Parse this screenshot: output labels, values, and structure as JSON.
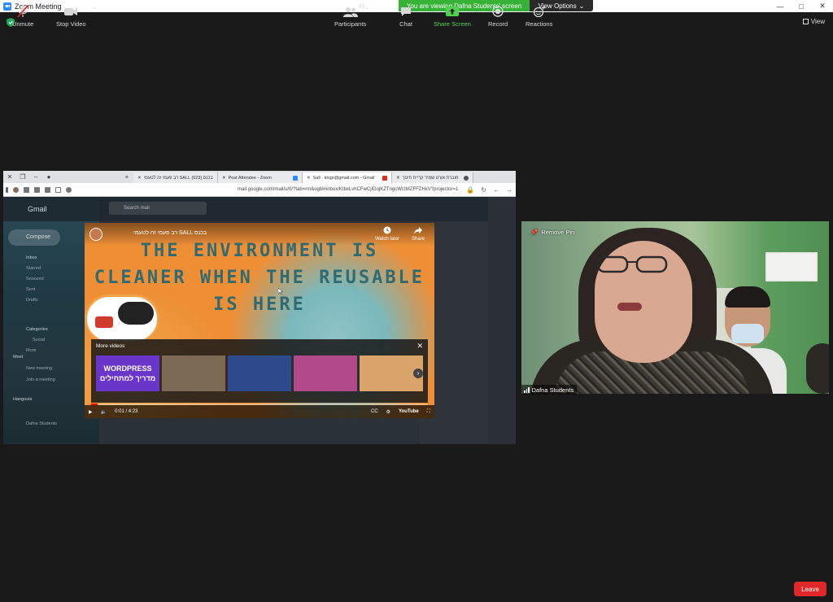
{
  "window": {
    "title": "Zoom Meeting"
  },
  "banner": {
    "text": "You are viewing Dafna Students' screen",
    "view_options_label": "View Options",
    "view_label": "View"
  },
  "browser": {
    "tabs": [
      {
        "label": "רב פעמי זה לטעמי SALL בכנס (623)"
      },
      {
        "label": "Post Attendee - Zoom"
      },
      {
        "label": "Sall - ktsgr@gmail.com - Gmail"
      },
      {
        "label": "חוברת אורט שמיר קריית חינוך"
      }
    ],
    "url": "mail.google.com/mail/u/0/?tab=rm&ogbl#inbox/KtbxLvhCFwCjlGojKZTngcWrzMZFFZHxV?projector=1"
  },
  "gmail": {
    "logo_text": "Gmail",
    "search_placeholder": "Search mail",
    "compose_label": "Compose",
    "sidebar_items": [
      "Inbox",
      "Starred",
      "Snoozed",
      "Sent",
      "Drafts",
      "Categories",
      "Social",
      "More",
      "Meet",
      "New meeting",
      "Join a meeting",
      "Hangouts"
    ],
    "user_name": "Dafna Students"
  },
  "youtube": {
    "title": "רב פעמי זה לטעמי SALL בכנס",
    "watch_later_label": "Watch later",
    "share_label": "Share",
    "headline_lines": [
      "THE ENVIRONMENT IS",
      "CLEANER WHEN THE REUSABLE",
      "IS HERE"
    ],
    "more_videos_label": "More videos",
    "thumbnails": [
      {
        "label": "WORDPRESS\nמדריך למתחילים",
        "color": "#6a36c9"
      },
      {
        "label": "",
        "color": "#7d6a55"
      },
      {
        "label": "",
        "color": "#2d4a8a"
      },
      {
        "label": "",
        "color": "#b04a8a"
      },
      {
        "label": "",
        "color": "#d9a56b"
      }
    ],
    "time": "0:01 / 4:23",
    "brand": "YouTube",
    "progress": 0.02
  },
  "camera": {
    "participant_name": "Dafna Students",
    "remove_pin_label": "Remove Pin"
  },
  "toolbar": {
    "unmute_label": "Unmute",
    "stop_video_label": "Stop Video",
    "participants_label": "Participants",
    "participants_count": "45",
    "chat_label": "Chat",
    "share_screen_label": "Share Screen",
    "record_label": "Record",
    "reactions_label": "Reactions",
    "leave_label": "Leave"
  },
  "colors": {
    "banner_green": "#36b336",
    "leave_red": "#e02828",
    "share_green": "#4fd14f",
    "zoom_blue": "#2d8cff"
  }
}
